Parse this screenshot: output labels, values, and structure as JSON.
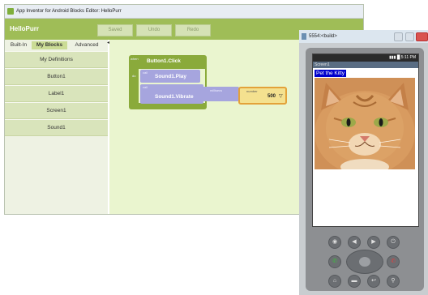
{
  "editor": {
    "window_title": "App Inventor for Android Blocks Editor: HelloPurr",
    "app_name": "HelloPurr",
    "toolbar": {
      "saved_label": "Saved",
      "undo_label": "Undo",
      "redo_label": "Redo"
    },
    "tabs": [
      {
        "label": "Built-In"
      },
      {
        "label": "My Blocks"
      },
      {
        "label": "Advanced"
      }
    ],
    "sidebar_items": [
      {
        "label": "My Definitions"
      },
      {
        "label": "Button1"
      },
      {
        "label": "Label1"
      },
      {
        "label": "Screen1"
      },
      {
        "label": "Sound1"
      }
    ],
    "blocks": {
      "event": {
        "keyword": "when",
        "name": "Button1.Click",
        "do_label": "do"
      },
      "play": {
        "call_label": "call",
        "name": "Sound1.Play"
      },
      "vibrate": {
        "call_label": "call",
        "name": "Sound1.Vibrate",
        "param_label": "millisecs"
      },
      "number": {
        "label": "number",
        "value": "500"
      }
    }
  },
  "emulator": {
    "window_title": "5554:<build>",
    "status_time": "5:11 PM",
    "screen_title": "Screen1",
    "label_text": "Pet the Kitty"
  },
  "colors": {
    "toolbar_green": "#9fbd57",
    "event_block": "#8aaa3b",
    "call_block": "#a6a5de",
    "workspace": "#eaf5cf",
    "label_bg": "#0000cc"
  }
}
